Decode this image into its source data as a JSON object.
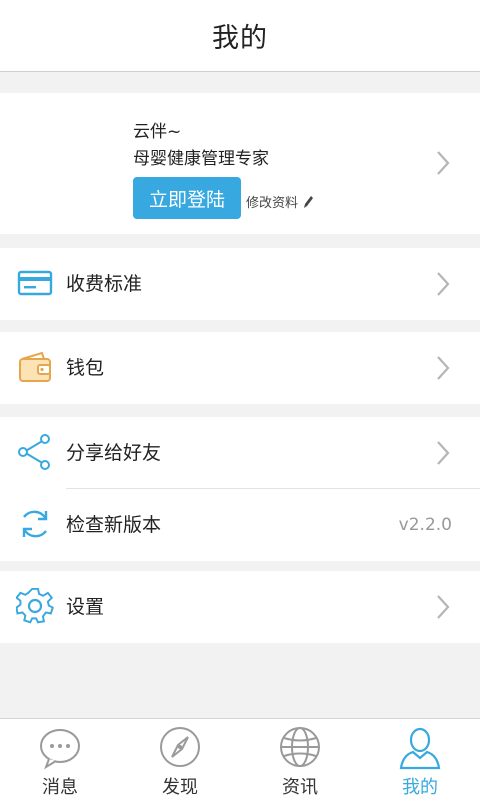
{
  "header": {
    "title": "我的"
  },
  "profile": {
    "name": "云伴~",
    "subtitle": "母婴健康管理专家",
    "login_label": "立即登陆",
    "edit_label": "修改资料"
  },
  "menu": {
    "fees": {
      "label": "收费标准",
      "icon": "card-icon"
    },
    "wallet": {
      "label": "钱包",
      "icon": "wallet-icon"
    },
    "share": {
      "label": "分享给好友",
      "icon": "share-icon"
    },
    "update": {
      "label": "检查新版本",
      "value": "v2.2.0",
      "icon": "refresh-icon"
    },
    "settings": {
      "label": "设置",
      "icon": "gear-icon"
    }
  },
  "tabs": [
    {
      "label": "消息",
      "icon": "chat-bubble-icon"
    },
    {
      "label": "发现",
      "icon": "compass-icon"
    },
    {
      "label": "资讯",
      "icon": "globe-icon"
    },
    {
      "label": "我的",
      "icon": "user-icon",
      "active": true
    }
  ],
  "colors": {
    "accent": "#38a9e0",
    "background": "#f2f2f2",
    "icon_gray": "#9a9a9a"
  }
}
